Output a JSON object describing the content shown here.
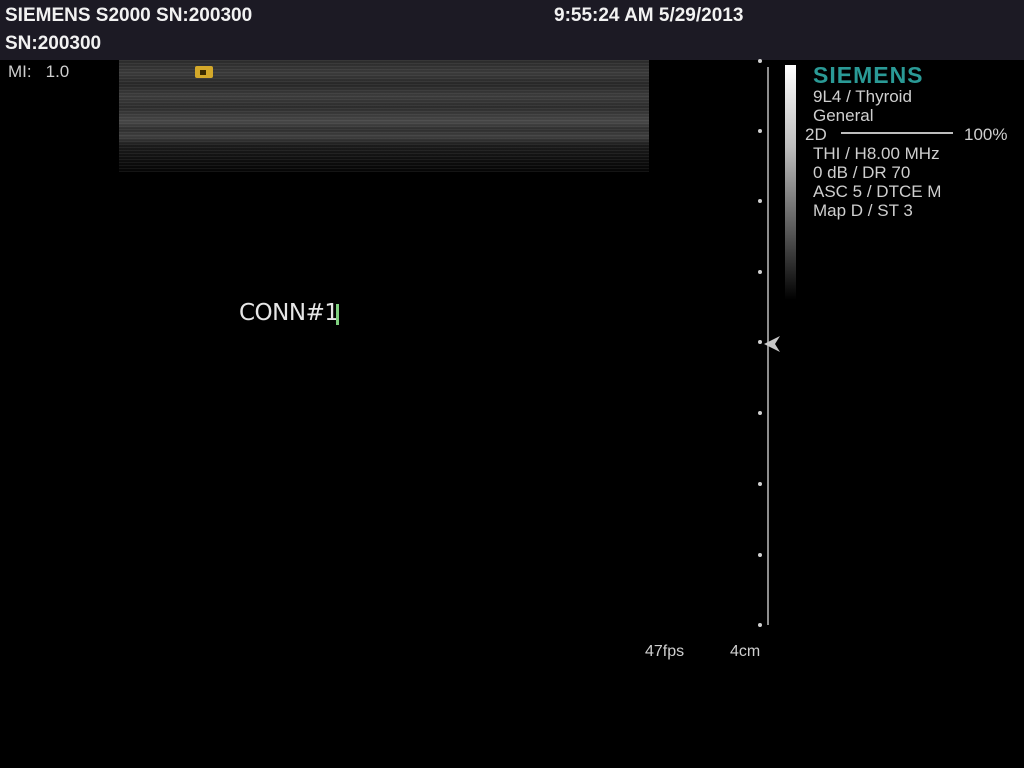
{
  "header": {
    "line1": "SIEMENS S2000 SN:200300",
    "line2": "SN:200300",
    "datetime": "9:55:24 AM 5/29/2013"
  },
  "mi": {
    "label": "MI:",
    "value": "1.0"
  },
  "annotation": {
    "text": "CONN#1"
  },
  "info_panel": {
    "brand": "SIEMENS",
    "transducer": "9L4 / Thyroid",
    "preset": "General",
    "mode": "2D",
    "mode_percent": "100%",
    "lines": [
      "THI / H8.00 MHz",
      "0 dB / DR 70",
      "ASC 5 / DTCE M",
      "Map D / ST 3"
    ]
  },
  "footer": {
    "fps": "47fps",
    "depth": "4cm"
  },
  "colors": {
    "header_bg": "#1c1a24",
    "brand": "#2a9a96",
    "orient_marker": "#d4a92a",
    "cursor": "#7fd07f"
  },
  "icons": {
    "orientation_marker": "orientation-marker-icon",
    "focus_marker": "focus-arrow-icon"
  }
}
